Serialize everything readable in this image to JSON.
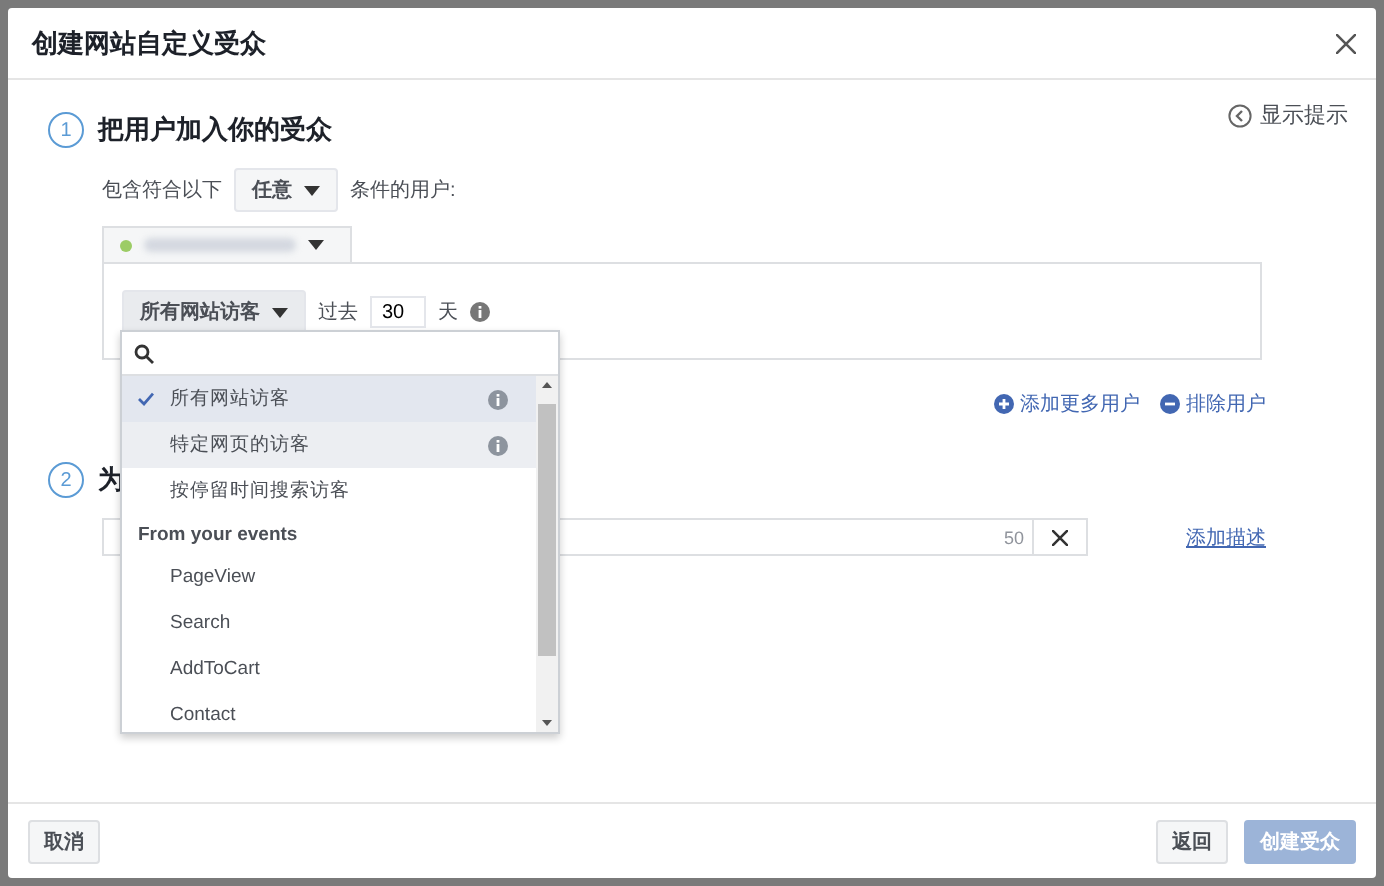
{
  "dialog": {
    "title": "创建网站自定义受众"
  },
  "hint_link": "显示提示",
  "steps": [
    {
      "number": "1",
      "title": "把用户加入你的受众"
    },
    {
      "number": "2",
      "title": "为"
    }
  ],
  "include": {
    "prefix": "包含符合以下",
    "match": "任意",
    "suffix": "条件的用户:"
  },
  "rule": {
    "source": "所有网站访客",
    "days_label": "过去",
    "days": "30",
    "unit": "天"
  },
  "dropdown": {
    "items": [
      {
        "kind": "option",
        "label": "所有网站访客",
        "selected": true,
        "hovered": false,
        "info": true
      },
      {
        "kind": "option",
        "label": "特定网页的访客",
        "selected": false,
        "hovered": true,
        "info": true
      },
      {
        "kind": "option",
        "label": "按停留时间搜索访客",
        "selected": false,
        "hovered": false,
        "info": false
      },
      {
        "kind": "header",
        "label": "From your events"
      },
      {
        "kind": "option",
        "label": "PageView",
        "selected": false,
        "hovered": false,
        "info": false
      },
      {
        "kind": "option",
        "label": "Search",
        "selected": false,
        "hovered": false,
        "info": false
      },
      {
        "kind": "option",
        "label": "AddToCart",
        "selected": false,
        "hovered": false,
        "info": false
      },
      {
        "kind": "option",
        "label": "Contact",
        "selected": false,
        "hovered": false,
        "info": false
      }
    ]
  },
  "links": [
    {
      "kind": "add",
      "label": "添加更多用户"
    },
    {
      "kind": "remove",
      "label": "排除用户"
    }
  ],
  "name_field": {
    "counter": "50"
  },
  "add_description": "添加描述",
  "footer": {
    "cancel": "取消",
    "back": "返回",
    "create": {
      "label": "创建受众",
      "disabled": true
    }
  }
}
